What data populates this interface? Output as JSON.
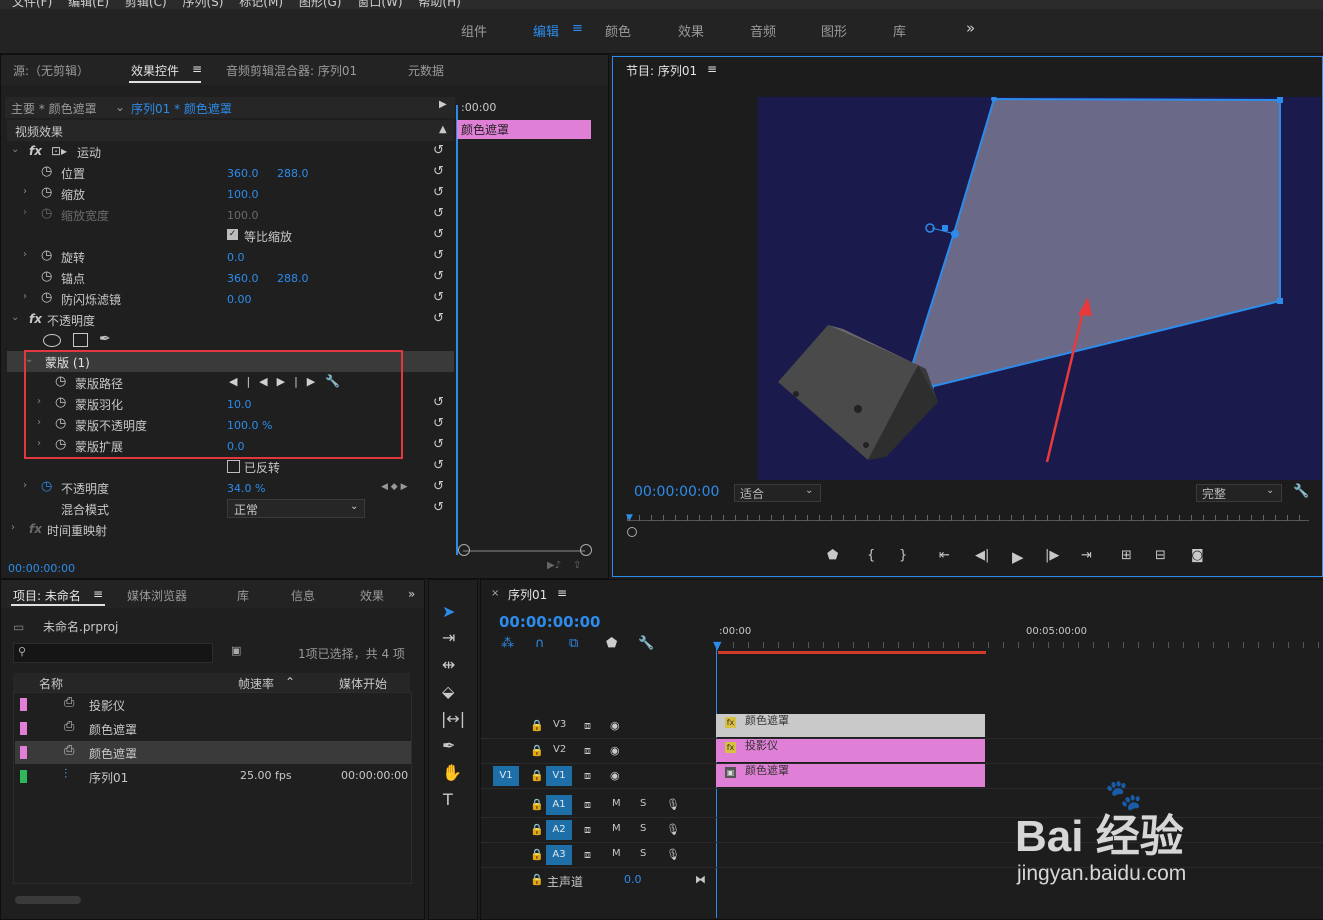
{
  "menu": [
    "文件(F)",
    "编辑(E)",
    "剪辑(C)",
    "序列(S)",
    "标记(M)",
    "图形(G)",
    "窗口(W)",
    "帮助(H)"
  ],
  "workspace": {
    "items": [
      "组件",
      "编辑",
      "颜色",
      "效果",
      "音频",
      "图形",
      "库"
    ],
    "more": "»",
    "active_index": 1
  },
  "left_tabs": [
    "源:（无剪辑）",
    "效果控件",
    "音频剪辑混合器: 序列01",
    "元数据"
  ],
  "effect_header": {
    "master": "主要 * 颜色遮罩",
    "sequence": "序列01 * 颜色遮罩",
    "time": ":00:00",
    "clip_label": "颜色遮罩"
  },
  "section_video": "视频效果",
  "effects": {
    "motion": "运动",
    "position": {
      "label": "位置",
      "x": "360.0",
      "y": "288.0"
    },
    "scale": {
      "label": "缩放",
      "value": "100.0"
    },
    "scale_width": {
      "label": "缩放宽度",
      "value": "100.0"
    },
    "uniform": "等比缩放",
    "rotation": {
      "label": "旋转",
      "value": "0.0"
    },
    "anchor": {
      "label": "锚点",
      "x": "360.0",
      "y": "288.0"
    },
    "antiflicker": {
      "label": "防闪烁滤镜",
      "value": "0.00"
    },
    "opacity_group": "不透明度",
    "mask": "蒙版 (1)",
    "mask_path": "蒙版路径",
    "mask_feather": {
      "label": "蒙版羽化",
      "value": "10.0"
    },
    "mask_opacity": {
      "label": "蒙版不透明度",
      "value": "100.0 %"
    },
    "mask_expansion": {
      "label": "蒙版扩展",
      "value": "0.0"
    },
    "inverted": "已反转",
    "opacity": {
      "label": "不透明度",
      "value": "34.0 %"
    },
    "blend": {
      "label": "混合模式",
      "value": "正常"
    },
    "time_remap": "时间重映射"
  },
  "effect_timecode": "00:00:00:00",
  "program": {
    "title": "节目: 序列01",
    "timecode": "00:00:00:00",
    "fit": "适合",
    "quality": "完整"
  },
  "project": {
    "tabs": [
      "项目: 未命名",
      "媒体浏览器",
      "库",
      "信息",
      "效果"
    ],
    "file": "未命名.prproj",
    "selection": "1项已选择，共 4 项",
    "columns": [
      "名称",
      "帧速率",
      "媒体开始"
    ],
    "items": [
      {
        "name": "投影仪",
        "color": "#e07fd6",
        "fps": "",
        "start": ""
      },
      {
        "name": "颜色遮罩",
        "color": "#e07fd6",
        "fps": "",
        "start": ""
      },
      {
        "name": "颜色遮罩",
        "color": "#e07fd6",
        "fps": "",
        "start": ""
      },
      {
        "name": "序列01",
        "color": "#2fb85a",
        "fps": "25.00 fps",
        "start": "00:00:00:00"
      }
    ]
  },
  "timeline": {
    "tab": "序列01",
    "timecode": "00:00:00:00",
    "ruler": [
      ":00:00",
      "00:05:00:00"
    ],
    "video_tracks": [
      {
        "name": "V3",
        "clip": "颜色遮罩",
        "clip_color": "#c9c9c9"
      },
      {
        "name": "V2",
        "clip": "投影仪",
        "clip_color": "#e07fd6"
      },
      {
        "name": "V1",
        "clip": "颜色遮罩",
        "clip_color": "#e07fd6"
      }
    ],
    "source_v": "V1",
    "audio_tracks": [
      "A1",
      "A2",
      "A3"
    ],
    "m": "M",
    "s": "S",
    "master": {
      "label": "主声道",
      "value": "0.0"
    }
  },
  "watermark": {
    "brand": "Bai 经验",
    "url": "jingyan.baidu.com"
  },
  "icons": [
    "play-icon",
    "wrench-icon",
    "eye-icon",
    "lock-icon",
    "search-icon",
    "selection-tool-icon",
    "hand-tool-icon",
    "text-tool-icon",
    "pen-tool-icon"
  ]
}
